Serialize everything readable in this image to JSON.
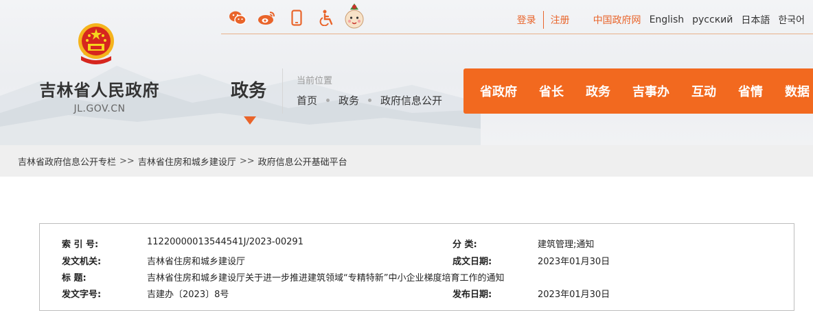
{
  "header": {
    "site_name": "吉林省人民政府",
    "site_domain": "JL.GOV.CN",
    "channel": "政务",
    "location_label": "当前位置",
    "location_crumbs": [
      "首页",
      "政务",
      "政府信息公开"
    ]
  },
  "topbar": {
    "icons": [
      "wechat-icon",
      "weibo-icon",
      "mobile-icon",
      "accessibility-icon",
      "mascot-icon"
    ],
    "login": "登录",
    "register": "注册",
    "gov_link": "中国政府网",
    "languages": [
      "English",
      "русский",
      "日本語",
      "한국어"
    ]
  },
  "main_nav": [
    "省政府",
    "省长",
    "政务",
    "吉事办",
    "互动",
    "省情",
    "数据"
  ],
  "breadcrumb": [
    "吉林省政府信息公开专栏",
    "吉林省住房和城乡建设厅",
    "政府信息公开基础平台"
  ],
  "breadcrumb_sep": ">>",
  "meta": {
    "index_label": "索 引 号:",
    "index_value": "11220000013544541J/2023-00291",
    "category_label": "分 类:",
    "category_value": "建筑管理;通知",
    "issuer_label": "发文机关:",
    "issuer_value": "吉林省住房和城乡建设厅",
    "date_label": "成文日期:",
    "date_value": "2023年01月30日",
    "title_label": "标 题:",
    "title_value": "吉林省住房和城乡建设厅关于进一步推进建筑领域“专精特新”中小企业梯度培育工作的通知",
    "doc_no_label": "发文字号:",
    "doc_no_value": "吉建办〔2023〕8号",
    "publish_label": "发布日期:",
    "publish_value": "2023年01月30日"
  },
  "colors": {
    "accent": "#f2691f",
    "link_orange": "#e9642a",
    "breadcrumb_bg": "#efefef"
  }
}
